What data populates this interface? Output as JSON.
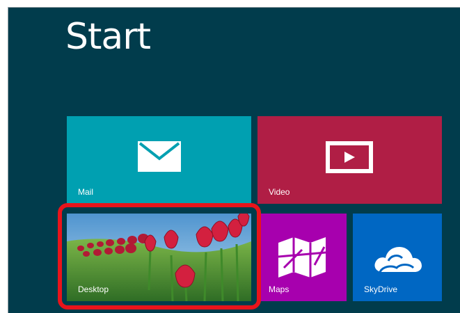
{
  "screen": {
    "title": "Start",
    "background_color": "#013c4c"
  },
  "tiles": [
    {
      "id": "mail",
      "label": "Mail",
      "color": "#00a0b1",
      "icon": "mail-icon"
    },
    {
      "id": "video",
      "label": "Video",
      "color": "#b01e45",
      "icon": "video-icon"
    },
    {
      "id": "desktop",
      "label": "Desktop",
      "color": "#6aa7d6",
      "icon": "tulip-wallpaper"
    },
    {
      "id": "maps",
      "label": "Maps",
      "color": "#a700ae",
      "icon": "map-icon"
    },
    {
      "id": "skydrive",
      "label": "SkyDrive",
      "color": "#0067c3",
      "icon": "cloud-icon"
    }
  ],
  "annotation": {
    "highlight_target": "Desktop",
    "highlight_color": "#e8141b"
  }
}
